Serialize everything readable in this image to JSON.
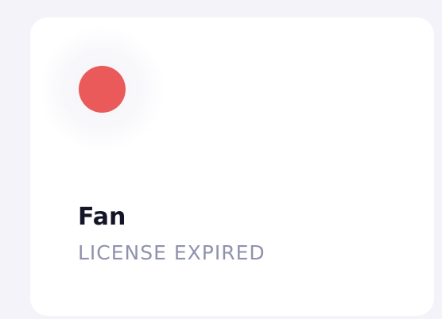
{
  "device_card": {
    "name": "Fan",
    "status": "LICENSE EXPIRED",
    "status_indicator": {
      "icon": "status-dot",
      "color": "#ea5a5a"
    }
  },
  "colors": {
    "page_background": "#f4f3f9",
    "card_background": "#ffffff",
    "name_text": "#15152a",
    "status_text": "#9092ad"
  }
}
